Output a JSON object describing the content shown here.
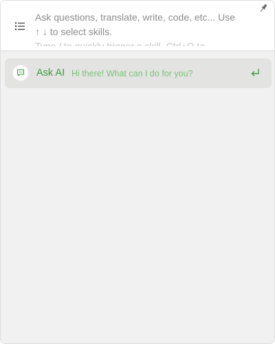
{
  "header": {
    "menu_icon": "list-icon",
    "input": {
      "placeholder_line1": "Ask questions, translate, write, code, etc... Use",
      "placeholder_line2": "↑ ↓ to select skills.",
      "placeholder_line3": "Type / to quickly trigger a skill, Ctrl+Q to"
    },
    "pin_icon": "pin-icon"
  },
  "skills": [
    {
      "icon": "chat-bubble-icon",
      "name": "Ask AI",
      "description": "Hi there! What can I do for you?",
      "action_icon": "enter-return-icon"
    }
  ],
  "colors": {
    "accent": "#3f9a3f",
    "accent_light": "#79c27a",
    "selected_row": "#e3e3e1",
    "panel_bg": "#f1f1f1",
    "placeholder_text": "#8c8c8c"
  }
}
